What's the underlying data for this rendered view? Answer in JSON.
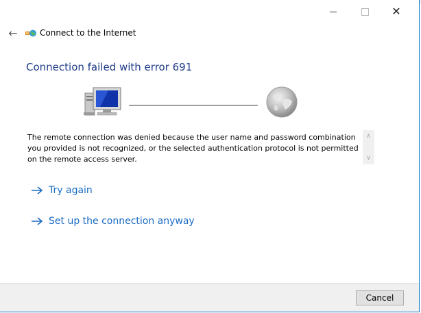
{
  "window": {
    "controls": {
      "minimize_icon": "minimize-icon",
      "maximize_icon": "maximize-icon",
      "close_glyph": "✕"
    }
  },
  "header": {
    "back_icon": "←",
    "title": "Connect to the Internet"
  },
  "main": {
    "heading": "Connection failed with error 691",
    "message": "The remote connection was denied because the user name and password combination you provided is not recognized, or the selected authentication protocol is not permitted on the remote access server."
  },
  "links": [
    {
      "label": "Try again"
    },
    {
      "label": "Set up the connection anyway"
    }
  ],
  "footer": {
    "cancel_label": "Cancel"
  },
  "colors": {
    "heading": "#1f3c8a",
    "link": "#1a6bc2",
    "window_border": "#1b7cc8"
  }
}
